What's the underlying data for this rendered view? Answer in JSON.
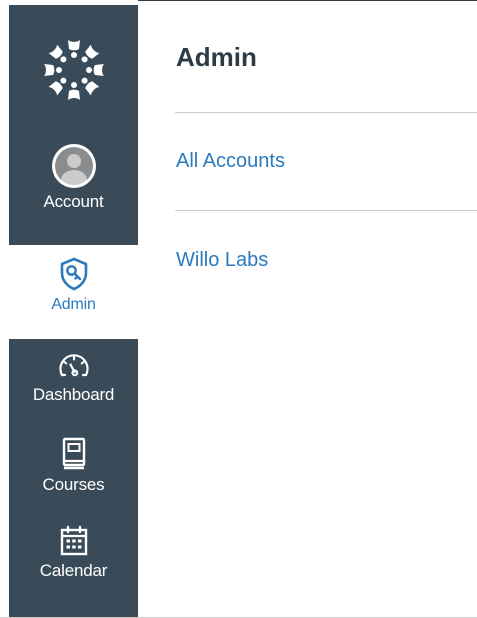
{
  "sidebar": {
    "logo_icon": "canvas-logo-icon",
    "items": [
      {
        "label": "Account",
        "icon": "avatar",
        "active": false
      },
      {
        "label": "Admin",
        "icon": "admin-shield-icon",
        "active": true
      },
      {
        "label": "Dashboard",
        "icon": "dashboard-gauge-icon",
        "active": false
      },
      {
        "label": "Courses",
        "icon": "courses-book-icon",
        "active": false
      },
      {
        "label": "Calendar",
        "icon": "calendar-icon",
        "active": false
      }
    ]
  },
  "main": {
    "title": "Admin",
    "accounts": [
      {
        "label": "All Accounts"
      },
      {
        "label": "Willo Labs"
      }
    ]
  },
  "colors": {
    "sidebar_bg": "#394b58",
    "active_text": "#2b7abc",
    "link": "#2b7abc",
    "title": "#2d3b45"
  }
}
